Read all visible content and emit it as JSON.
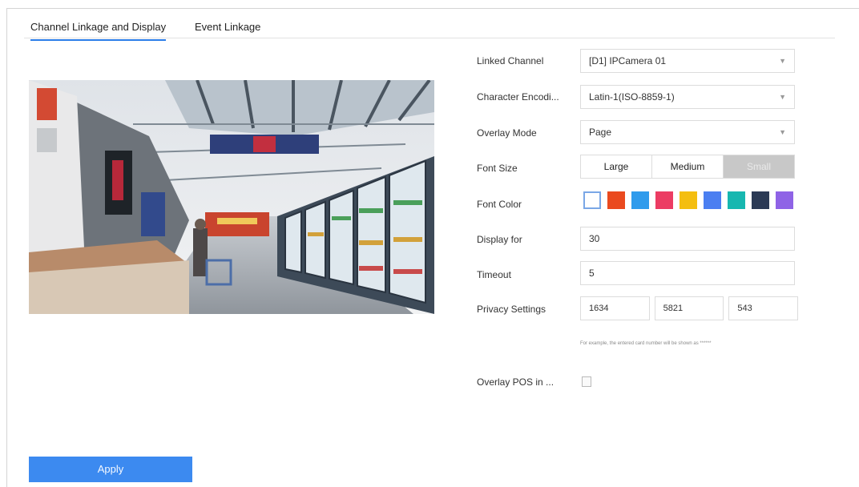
{
  "tabs": [
    {
      "label": "Channel Linkage and Display"
    },
    {
      "label": "Event Linkage"
    }
  ],
  "form": {
    "linked_channel": {
      "label": "Linked Channel",
      "value": "[D1] IPCamera 01"
    },
    "character_encoding": {
      "label": "Character Encodi...",
      "value": "Latin-1(ISO-8859-1)"
    },
    "overlay_mode": {
      "label": "Overlay Mode",
      "value": "Page"
    },
    "font_size": {
      "label": "Font Size",
      "options": [
        "Large",
        "Medium",
        "Small"
      ],
      "selected": "Small"
    },
    "font_color": {
      "label": "Font Color",
      "swatches": [
        "#ffffff",
        "#ea4a1f",
        "#2f9bec",
        "#ec3c63",
        "#f4be10",
        "#4b7ff1",
        "#17b7b0",
        "#2b3a55",
        "#8f63e6"
      ],
      "selected": "#ffffff"
    },
    "display_for": {
      "label": "Display for",
      "value": "30"
    },
    "timeout": {
      "label": "Timeout",
      "value": "5"
    },
    "privacy_settings": {
      "label": "Privacy Settings",
      "values": [
        "1634",
        "5821",
        "543"
      ]
    },
    "privacy_hint": "For example, the entered card number will be shown as ******",
    "overlay_pos": {
      "label": "Overlay POS in ...",
      "checked": false
    }
  },
  "apply_label": "Apply",
  "colors": {
    "accent": "#3c8af0",
    "selected_segment": "#c8c8c8"
  }
}
